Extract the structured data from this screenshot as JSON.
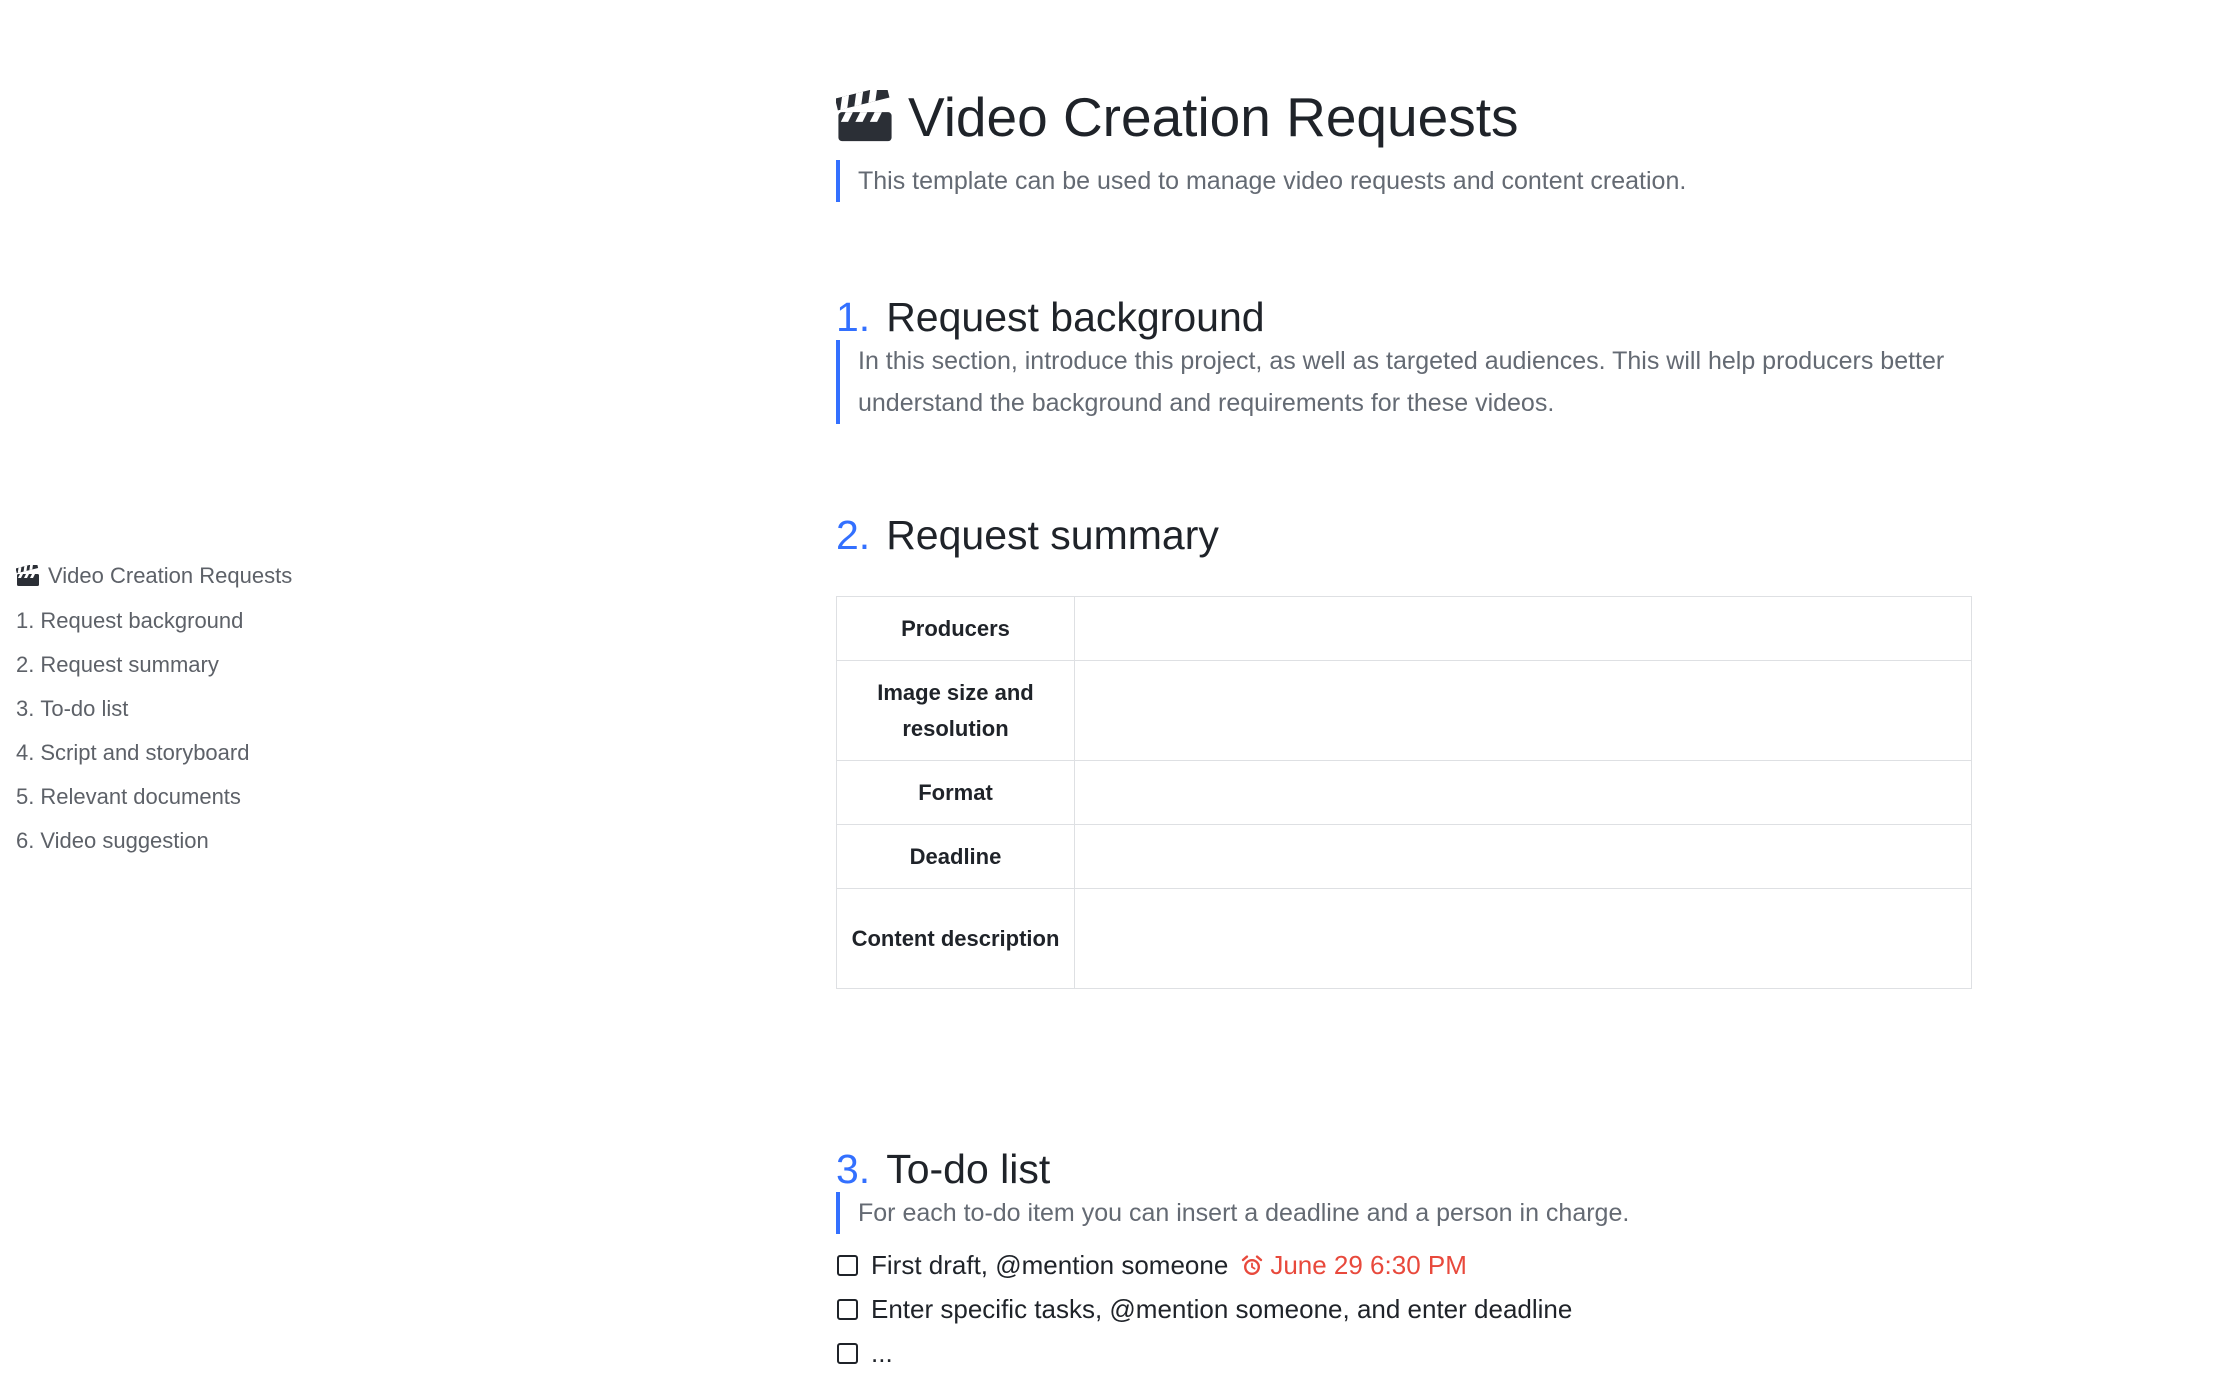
{
  "colors": {
    "accent": "#3370ff",
    "text": "#1f2329",
    "muted": "#646a73",
    "reminder": "#e8493c",
    "border": "#dee0e3"
  },
  "outline": {
    "doc_title": "Video Creation Requests",
    "items": [
      {
        "num": "1.",
        "label": "Request background"
      },
      {
        "num": "2.",
        "label": "Request summary"
      },
      {
        "num": "3.",
        "label": "To-do list"
      },
      {
        "num": "4.",
        "label": "Script and storyboard"
      },
      {
        "num": "5.",
        "label": "Relevant documents"
      },
      {
        "num": "6.",
        "label": "Video suggestion"
      }
    ]
  },
  "doc": {
    "title_icon": "clapperboard-icon",
    "title": "Video Creation Requests",
    "intro": "This template can be used to manage video requests and content creation.",
    "sections": [
      {
        "num": "1.",
        "title": "Request background",
        "quote": "In this section, introduce this project, as well as targeted audiences. This will help producers better understand the background and requirements for these videos."
      },
      {
        "num": "2.",
        "title": "Request summary"
      },
      {
        "num": "3.",
        "title": "To-do list",
        "quote": "For each to-do item you can insert a deadline and a person in charge."
      }
    ],
    "summary_table": {
      "rows": [
        {
          "label": "Producers",
          "value": ""
        },
        {
          "label": "Image size and resolution",
          "value": ""
        },
        {
          "label": "Format",
          "value": ""
        },
        {
          "label": "Deadline",
          "value": ""
        },
        {
          "label": "Content description",
          "value": ""
        }
      ]
    },
    "todos": [
      {
        "text": "First draft, @mention someone",
        "checked": false,
        "reminder_icon": "alarm-clock-icon",
        "reminder": "June 29 6:30 PM"
      },
      {
        "text": "Enter specific tasks, @mention someone, and enter deadline",
        "checked": false
      },
      {
        "text": "...",
        "checked": false
      }
    ]
  }
}
